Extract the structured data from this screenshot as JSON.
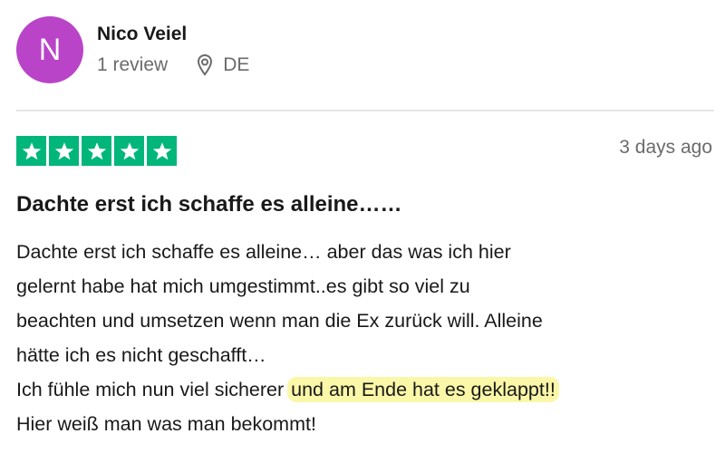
{
  "reviewer": {
    "initial": "N",
    "name": "Nico Veiel",
    "review_count": "1 review",
    "country": "DE",
    "avatar_color": "#b944c8",
    "location_icon": "location-pin-icon"
  },
  "review": {
    "rating": 5,
    "max_rating": 5,
    "star_color": "#00b67a",
    "star_icon": "star-icon",
    "date": "3 days ago",
    "title": "Dachte erst ich schaffe es alleine……",
    "body_lines": [
      "Dachte erst ich schaffe es alleine… aber das was ich hier",
      "gelernt habe hat mich umgestimmt..es gibt so viel zu",
      "beachten und umsetzen wenn man die Ex zurück will. Alleine",
      "hätte ich es nicht geschafft…"
    ],
    "line5_plain": "Ich fühle mich nun viel sicherer ",
    "line5_highlight": "und am Ende hat es geklappt!!",
    "line6": "Hier weiß man was man bekommt!",
    "highlight_color": "#fbf7a8"
  }
}
